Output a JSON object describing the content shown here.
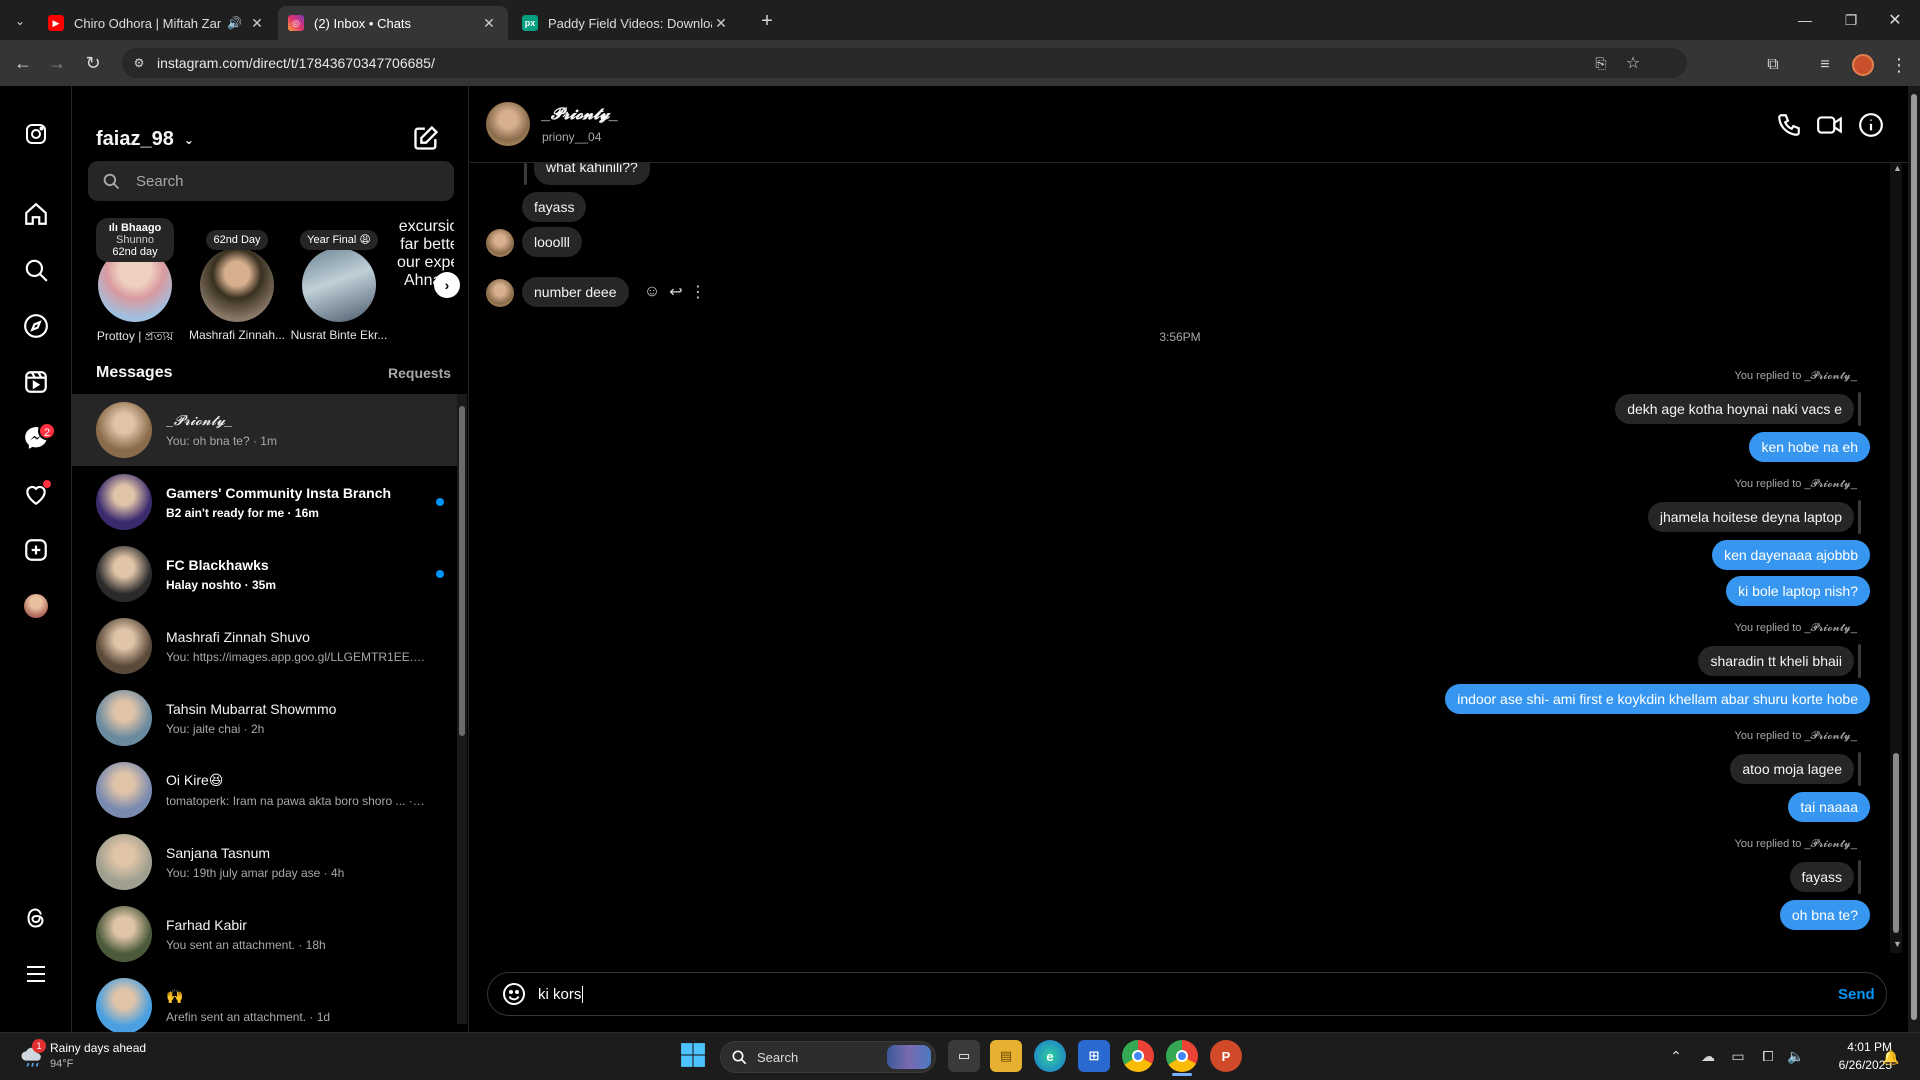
{
  "browser": {
    "tabs": [
      {
        "title": "Chiro Odhora | Miftah Zam",
        "favicon_color": "#ff0000"
      },
      {
        "title": "(2) Inbox • Chats",
        "favicon_color": "#e1306c"
      },
      {
        "title": "Paddy Field Videos: Download",
        "favicon_color": "#05a081",
        "favicon_text": "px"
      }
    ],
    "url": "instagram.com/direct/t/17843670347706685/"
  },
  "rail": {
    "notification_badge": "2"
  },
  "inbox": {
    "username": "faiaz_98",
    "search_placeholder": "Search",
    "stories": [
      {
        "note_title": "ılı Bhaago",
        "note_line2": "Shunno",
        "note_line3": "62nd day",
        "name": "Prottoy | প্রত্যয়"
      },
      {
        "note_title": "62nd Day",
        "name": "Mashrafi Zinnah..."
      },
      {
        "note_title": "Year Final 😩",
        "name": "Nusrat Binte Ekr..."
      },
      {
        "note_title": "excursion w",
        "note_line2": "far better th",
        "note_line3": "our expectat",
        "name": "Ahnaf Tahn"
      }
    ],
    "messages_label": "Messages",
    "requests_label": "Requests",
    "conversations": [
      {
        "name": "_𝓟𝓻𝓲𝓸𝓷𝓽𝔂_",
        "preview": "You: oh bna te? · 1m",
        "selected": true,
        "unread": false,
        "color": "#8a6b4a"
      },
      {
        "name": "Gamers' Community Insta Branch",
        "preview": "B2 ain't ready for me · 16m",
        "selected": false,
        "unread": true,
        "color": "#3a2a6e"
      },
      {
        "name": "FC Blackhawks",
        "preview": "Halay noshto · 35m",
        "selected": false,
        "unread": true,
        "color": "#2a2a2a"
      },
      {
        "name": "Mashrafi Zinnah Shuvo",
        "preview": "You: https://images.app.goo.gl/LLGEMTR1EE... · 2h",
        "selected": false,
        "unread": false,
        "color": "#5a4a3a"
      },
      {
        "name": "Tahsin Mubarrat Showmmo",
        "preview": "You: jaite chai · 2h",
        "selected": false,
        "unread": false,
        "color": "#6a8aa0"
      },
      {
        "name": "Oi Kire😆",
        "preview": "tomatoperk: Iram na pawa akta boro shoro ... · 3h",
        "selected": false,
        "unread": false,
        "color": "#7a8ab0"
      },
      {
        "name": "Sanjana Tasnum",
        "preview": "You: 19th july amar pday ase · 4h",
        "selected": false,
        "unread": false,
        "color": "#a0a090"
      },
      {
        "name": "Farhad Kabir",
        "preview": "You sent an attachment. · 18h",
        "selected": false,
        "unread": false,
        "color": "#4a5a3a"
      },
      {
        "name": "🙌",
        "preview": "Arefin sent an attachment. · 1d",
        "selected": false,
        "unread": false,
        "color": "#4aa0e0"
      }
    ]
  },
  "chat": {
    "display_name": "_𝓟𝓻𝓲𝓸𝓷𝓽𝔂_",
    "handle": "priony__04",
    "top_partial": "what kahinili??",
    "incoming_top": [
      "fayass",
      "looolll",
      "number deee"
    ],
    "timestamp": "3:56PM",
    "replied_label": "You replied to _𝓟𝓻𝓲𝓸𝓷𝓽𝔂_",
    "groups": [
      {
        "quoted": "dekh age kotha hoynai naki vacs e",
        "replies": [
          "ken hobe na eh"
        ]
      },
      {
        "quoted": "jhamela hoitese deyna laptop",
        "replies": [
          "ken dayenaaa ajobbb",
          "ki bole laptop nish?"
        ]
      },
      {
        "quoted": "sharadin tt kheli bhaii",
        "replies": [
          "indoor ase shi- ami first e koykdin khellam abar shuru korte hobe"
        ]
      },
      {
        "quoted": "atoo moja lagee",
        "replies": [
          "tai naaaa"
        ]
      },
      {
        "quoted": "fayass",
        "replies": [
          "oh bna te?"
        ]
      }
    ],
    "composer_value": "ki kors",
    "send_label": "Send"
  },
  "taskbar": {
    "weather_title": "Rainy days ahead",
    "weather_temp": "94°F",
    "weather_badge": "1",
    "search_label": "Search",
    "time": "4:01 PM",
    "date": "6/26/2025"
  }
}
